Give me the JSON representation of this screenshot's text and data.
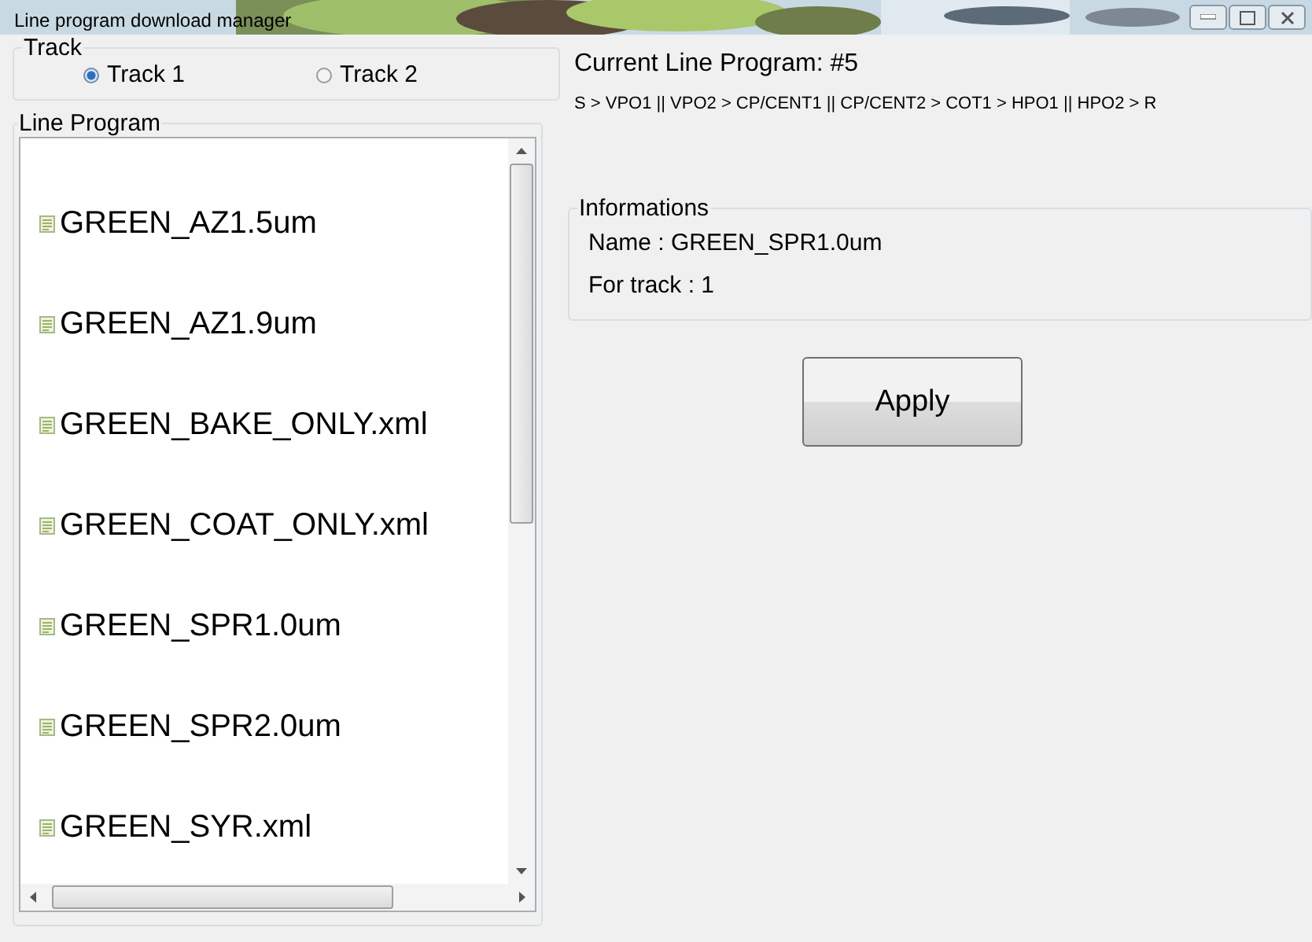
{
  "window": {
    "title": "Line program download manager"
  },
  "track": {
    "label": "Track",
    "options": [
      {
        "label": "Track 1",
        "selected": true
      },
      {
        "label": "Track 2",
        "selected": false
      }
    ]
  },
  "line_program": {
    "label": "Line Program",
    "items": [
      {
        "label": "GREEN_AZ1.5um"
      },
      {
        "label": "GREEN_AZ1.9um"
      },
      {
        "label": "GREEN_BAKE_ONLY.xml"
      },
      {
        "label": "GREEN_COAT_ONLY.xml"
      },
      {
        "label": "GREEN_SPR1.0um"
      },
      {
        "label": "GREEN_SPR2.0um"
      },
      {
        "label": "GREEN_SYR.xml"
      }
    ]
  },
  "current": {
    "title": "Current Line Program: #5",
    "route": "S > VPO1 || VPO2 > CP/CENT1 || CP/CENT2 > COT1 > HPO1 || HPO2 > R"
  },
  "informations": {
    "label": "Informations",
    "lines": [
      "Name : GREEN_SPR1.0um",
      "For track : 1"
    ]
  },
  "apply_button": "Apply"
}
